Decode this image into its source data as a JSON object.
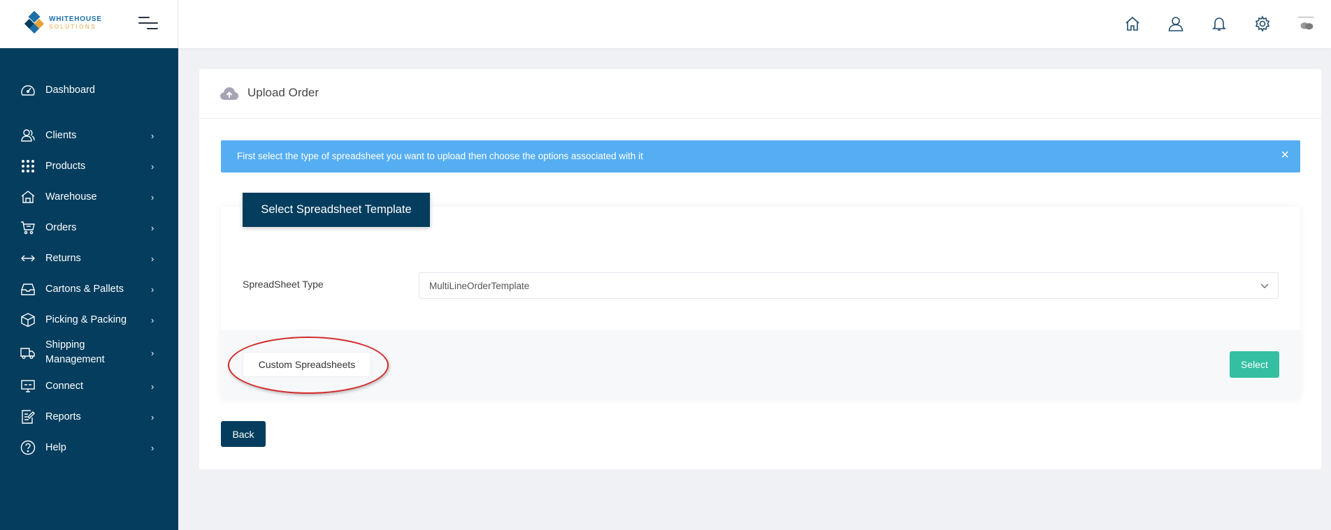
{
  "brand": {
    "name_line1": "WHITEHOUSE",
    "name_line2": "SOLUTIONS",
    "primary": "#043d5d",
    "accent": "#e8a33a"
  },
  "topbar": {
    "icons": [
      "home-icon",
      "user-icon",
      "bell-icon",
      "gear-icon",
      "avatar"
    ]
  },
  "sidebar": {
    "items": [
      {
        "label": "Dashboard",
        "icon": "dashboard-icon",
        "has_submenu": false
      },
      {
        "label": "Clients",
        "icon": "clients-icon",
        "has_submenu": true
      },
      {
        "label": "Products",
        "icon": "products-grid-icon",
        "has_submenu": true
      },
      {
        "label": "Warehouse",
        "icon": "warehouse-icon",
        "has_submenu": true
      },
      {
        "label": "Orders",
        "icon": "cart-icon",
        "has_submenu": true
      },
      {
        "label": "Returns",
        "icon": "returns-icon",
        "has_submenu": true
      },
      {
        "label": "Cartons & Pallets",
        "icon": "cartons-icon",
        "has_submenu": true
      },
      {
        "label": "Picking & Packing",
        "icon": "box-icon",
        "has_submenu": true
      },
      {
        "label": "Shipping Management",
        "icon": "truck-icon",
        "has_submenu": true
      },
      {
        "label": "Connect",
        "icon": "connect-icon",
        "has_submenu": true
      },
      {
        "label": "Reports",
        "icon": "reports-icon",
        "has_submenu": true
      },
      {
        "label": "Help",
        "icon": "help-icon",
        "has_submenu": true
      }
    ]
  },
  "page": {
    "title": "Upload Order",
    "alert": {
      "text": "First select the type of spreadsheet you want to upload then choose the options associated with it",
      "close": "×",
      "color": "#56aef2"
    },
    "panel": {
      "tag": "Select Spreadsheet Template",
      "field_label": "SpreadSheet Type",
      "select_value": "MultiLineOrderTemplate",
      "custom_button": "Custom Spreadsheets",
      "select_button": "Select",
      "select_button_color": "#34bfa3"
    },
    "back_button": "Back"
  }
}
